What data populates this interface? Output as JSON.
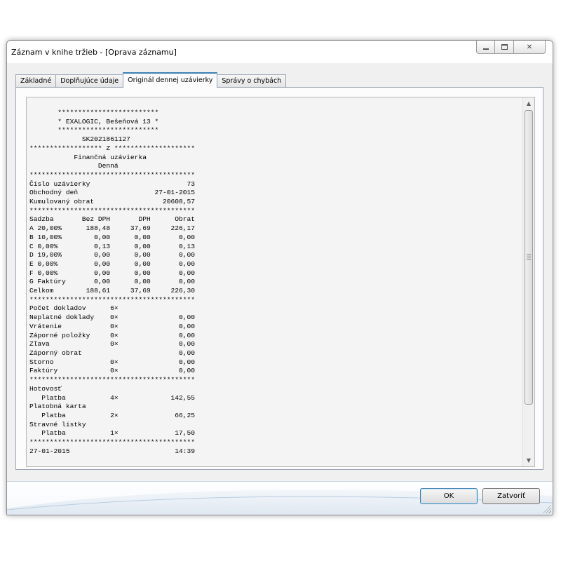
{
  "window": {
    "title": "Záznam v knihe tržieb - [Oprava záznamu]"
  },
  "tabs": [
    {
      "label": "Základné"
    },
    {
      "label": "Doplňujúce údaje"
    },
    {
      "label": "Originál dennej uzávierky"
    },
    {
      "label": "Správy o chybách"
    }
  ],
  "active_tab": "Originál dennej uzávierky",
  "receipt": {
    "lines": [
      "       *************************",
      "       * EXALOGIC, Bešeňová 13 *",
      "       *************************",
      "             SK2021861127",
      "****************** Z ********************",
      "           Finančná uzávierka",
      "                 Denná",
      "*****************************************",
      "Číslo uzávierky                        73",
      "Obchodný deň                   27-01-2015",
      "Kumulovaný obrat                 20608,57",
      "*****************************************",
      "Sadzba       Bez DPH       DPH      Obrat",
      "A 20,00%      188,48     37,69     226,17",
      "B 10,00%        0,00      0,00       0,00",
      "C 0,00%         0,13      0,00       0,13",
      "D 19,00%        0,00      0,00       0,00",
      "E 0,00%         0,00      0,00       0,00",
      "F 0,00%         0,00      0,00       0,00",
      "G Faktúry       0,00      0,00       0,00",
      "Celkom        188,61     37,69     226,30",
      "*****************************************",
      "Počet dokladov      6×",
      "Neplatné doklady    0×               0,00",
      "Vrátenie            0×               0,00",
      "Záporné položky     0×               0,00",
      "Zľava               0×               0,00",
      "Záporný obrat                        0,00",
      "Storno              0×               0,00",
      "Faktúry             0×               0,00",
      "*****************************************",
      "Hotovosť",
      "   Platba           4×             142,55",
      "Platobná karta",
      "   Platba           2×              66,25",
      "Stravné lístky",
      "   Platba           1×              17,50",
      "*****************************************",
      "27-01-2015                          14:39"
    ]
  },
  "buttons": {
    "ok": "OK",
    "close": "Zatvoriť"
  },
  "icons": {
    "minimize": "minimize-icon",
    "maximize": "maximize-icon",
    "close": "close-icon",
    "scroll_up": "chevron-up-icon",
    "scroll_down": "chevron-down-icon"
  }
}
